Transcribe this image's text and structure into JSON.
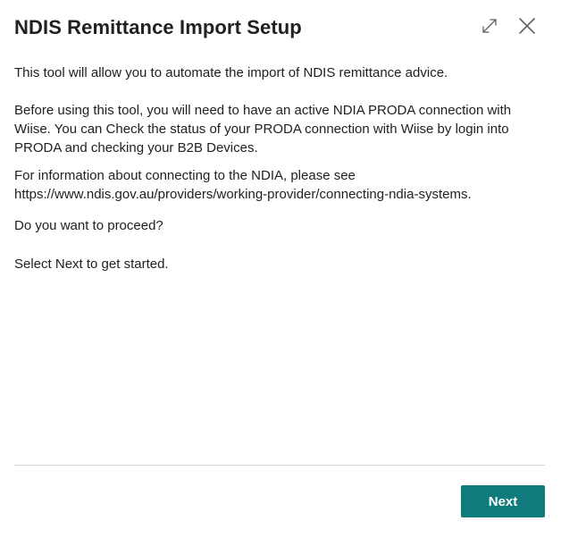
{
  "dialog": {
    "title": "NDIS Remittance Import Setup",
    "expand_icon": "expand-diagonal-icon",
    "close_icon": "close-x-icon"
  },
  "content": {
    "intro": "This tool will allow you to automate the import of NDIS remittance advice.",
    "before_using": "Before using this tool, you will need to have an active NDIA PRODA connection with Wiise. You can Check the status of your PRODA connection with Wiise by login into PRODA and checking your B2B Devices.",
    "info_line1": "For information about connecting to the NDIA, please see",
    "info_line2": "https://www.ndis.gov.au/providers/working-provider/connecting-ndia-systems.",
    "proceed": "Do you want to proceed?",
    "select_next": "Select Next to get started."
  },
  "footer": {
    "next_label": "Next"
  },
  "colors": {
    "accent": "#0f7b7c",
    "text": "#212121",
    "divider": "#d6d6d6",
    "icon": "#616161"
  }
}
